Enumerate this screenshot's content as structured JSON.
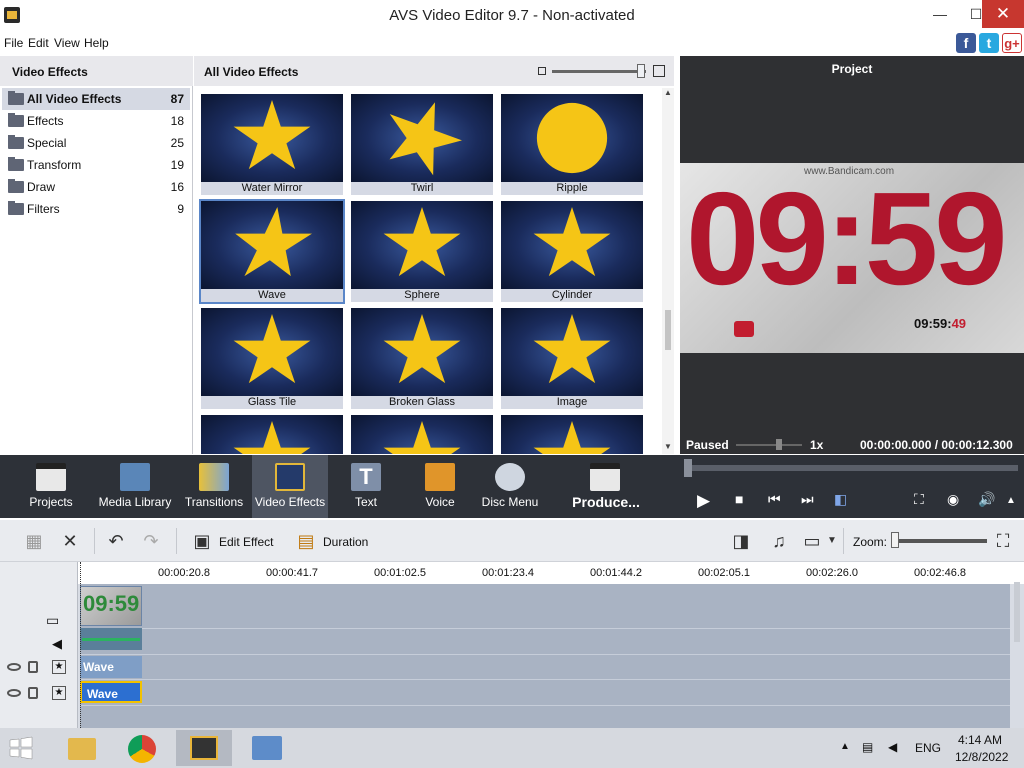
{
  "window": {
    "title": "AVS Video Editor 9.7 - Non-activated",
    "min": "—",
    "max": "☐",
    "close": "✕"
  },
  "menu": [
    "File",
    "Edit",
    "View",
    "Help"
  ],
  "social": {
    "fb": "f",
    "tw": "t",
    "gp": "g+"
  },
  "categories": {
    "header": "Video Effects",
    "items": [
      {
        "label": "All Video Effects",
        "count": "87"
      },
      {
        "label": "Effects",
        "count": "18"
      },
      {
        "label": "Special",
        "count": "25"
      },
      {
        "label": "Transform",
        "count": "19"
      },
      {
        "label": "Draw",
        "count": "16"
      },
      {
        "label": "Filters",
        "count": "9"
      }
    ]
  },
  "effects": {
    "header": "All Video Effects",
    "tiles": [
      "Water Mirror",
      "Twirl",
      "Ripple",
      "Wave",
      "Sphere",
      "Cylinder",
      "Glass Tile",
      "Broken Glass",
      "Image"
    ]
  },
  "project": {
    "header": "Project",
    "watermark": "www.Bandicam.com",
    "digits": "09:59",
    "clock_main": "09:59:",
    "clock_sec": "49",
    "status": "Paused",
    "speed": "1x",
    "timecode": "00:00:00.000 / 00:00:12.300"
  },
  "toolbar": {
    "buttons": [
      "Projects",
      "Media Library",
      "Transitions",
      "Video Effects",
      "Text",
      "Voice",
      "Disc Menu",
      "Produce..."
    ]
  },
  "timeline_toolbar": {
    "edit_effect": "Edit Effect",
    "duration": "Duration",
    "zoom": "Zoom:"
  },
  "timeline": {
    "ruler": [
      "00:00:20.8",
      "00:00:41.7",
      "00:01:02.5",
      "00:01:23.4",
      "00:01:44.2",
      "00:02:05.1",
      "00:02:26.0",
      "00:02:46.8"
    ],
    "clip_thumb": "09:59",
    "fx1": "Wave",
    "fx2": "Wave"
  },
  "taskbar": {
    "lang": "ENG",
    "time": "4:14 AM",
    "date": "12/8/2022"
  }
}
